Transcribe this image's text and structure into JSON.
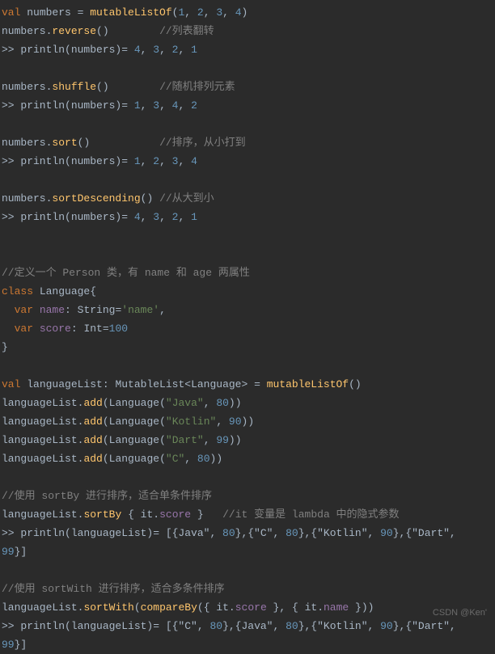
{
  "code": {
    "l1": {
      "kw1": "val",
      "id1": "numbers",
      "op1": " = ",
      "fn1": "mutableListOf",
      "p1": "(",
      "n1": "1",
      "c1": ", ",
      "n2": "2",
      "c2": ", ",
      "n3": "3",
      "c3": ", ",
      "n4": "4",
      "p2": ")"
    },
    "l2": {
      "id1": "numbers",
      "dot": ".",
      "fn1": "reverse",
      "p": "()",
      "sp": "        ",
      "cm": "//列表翻转"
    },
    "l3": {
      "pre": ">> println(numbers)= ",
      "n1": "4",
      "c1": ", ",
      "n2": "3",
      "c2": ", ",
      "n3": "2",
      "c3": ", ",
      "n4": "1"
    },
    "l5": {
      "id1": "numbers",
      "dot": ".",
      "fn1": "shuffle",
      "p": "()",
      "sp": "        ",
      "cm": "//随机排列元素"
    },
    "l6": {
      "pre": ">> println(numbers)= ",
      "n1": "1",
      "c1": ", ",
      "n2": "3",
      "c2": ", ",
      "n3": "4",
      "c3": ", ",
      "n4": "2"
    },
    "l8": {
      "id1": "numbers",
      "dot": ".",
      "fn1": "sort",
      "p": "()",
      "sp": "           ",
      "cm": "//排序，从小打到"
    },
    "l9": {
      "pre": ">> println(numbers)= ",
      "n1": "1",
      "c1": ", ",
      "n2": "2",
      "c2": ", ",
      "n3": "3",
      "c3": ", ",
      "n4": "4"
    },
    "l11": {
      "id1": "numbers",
      "dot": ".",
      "fn1": "sortDescending",
      "p": "()",
      "sp": " ",
      "cm": "//从大到小"
    },
    "l12": {
      "pre": ">> println(numbers)= ",
      "n1": "4",
      "c1": ", ",
      "n2": "3",
      "c2": ", ",
      "n3": "2",
      "c3": ", ",
      "n4": "1"
    },
    "l14": {
      "cm": "//定义一个 Person 类，有 name 和 age 两属性"
    },
    "l15": {
      "kw1": "class",
      "sp": " ",
      "id1": "Language",
      "br": "{"
    },
    "l16": {
      "sp": "  ",
      "kw1": "var",
      "sp2": " ",
      "id1": "name",
      "col": ": ",
      "ty": "String",
      "eq": "=",
      "str": "'name'",
      "cm": ","
    },
    "l17": {
      "sp": "  ",
      "kw1": "var",
      "sp2": " ",
      "id1": "score",
      "col": ": ",
      "ty": "Int",
      "eq": "=",
      "n1": "100"
    },
    "l18": {
      "br": "}"
    },
    "l20": {
      "kw1": "val",
      "sp": " ",
      "id1": "languageList",
      "col": ": ",
      "ty": "MutableList<Language>",
      "eq": " = ",
      "fn": "mutableListOf",
      "p": "()"
    },
    "l21": {
      "id1": "languageList",
      "dot": ".",
      "fn1": "add",
      "p1": "(",
      "fn2": "Language",
      "p2": "(",
      "str": "\"Java\"",
      "c": ", ",
      "n": "80",
      "p3": "))"
    },
    "l22": {
      "id1": "languageList",
      "dot": ".",
      "fn1": "add",
      "p1": "(",
      "fn2": "Language",
      "p2": "(",
      "str": "\"Kotlin\"",
      "c": ", ",
      "n": "90",
      "p3": "))"
    },
    "l23": {
      "id1": "languageList",
      "dot": ".",
      "fn1": "add",
      "p1": "(",
      "fn2": "Language",
      "p2": "(",
      "str": "\"Dart\"",
      "c": ", ",
      "n": "99",
      "p3": "))"
    },
    "l24": {
      "id1": "languageList",
      "dot": ".",
      "fn1": "add",
      "p1": "(",
      "fn2": "Language",
      "p2": "(",
      "str": "\"C\"",
      "c": ", ",
      "n": "80",
      "p3": "))"
    },
    "l26": {
      "cm": "//使用 sortBy 进行排序，适合单条件排序"
    },
    "l27": {
      "id1": "languageList",
      "dot": ".",
      "fn1": "sortBy",
      "sp": " ",
      "br1": "{ ",
      "id2": "it",
      "dot2": ".",
      "id3": "score",
      "br2": " }",
      "sp2": "   ",
      "cm": "//it 变量是 lambda 中的隐式参数"
    },
    "l28": {
      "pre": ">> println(languageList)= [{Java\", ",
      "n1": "80",
      "t1": "},{\"C\", ",
      "n2": "80",
      "t2": "},{\"Kotlin\", ",
      "n3": "90",
      "t3": "},{\"Dart\", "
    },
    "l29": {
      "n1": "99",
      "t1": "}]"
    },
    "l31": {
      "cm": "//使用 sortWith 进行排序，适合多条件排序"
    },
    "l32": {
      "id1": "languageList",
      "dot": ".",
      "fn1": "sortWith",
      "p1": "(",
      "fn2": "compareBy",
      "p2": "(",
      "br1": "{ ",
      "id2": "it",
      "dot2": ".",
      "id3": "score",
      "br2": " }",
      "c": ", ",
      "br3": "{ ",
      "id4": "it",
      "dot3": ".",
      "id5": "name",
      "br4": " }",
      "p3": "))"
    },
    "l33": {
      "pre": ">> println(languageList)= [{\"C\", ",
      "n1": "80",
      "t1": "},{Java\", ",
      "n2": "80",
      "t2": "},{\"Kotlin\", ",
      "n3": "90",
      "t3": "},{\"Dart\", "
    },
    "l34": {
      "n1": "99",
      "t1": "}]"
    }
  },
  "watermark": "CSDN @Ken'"
}
